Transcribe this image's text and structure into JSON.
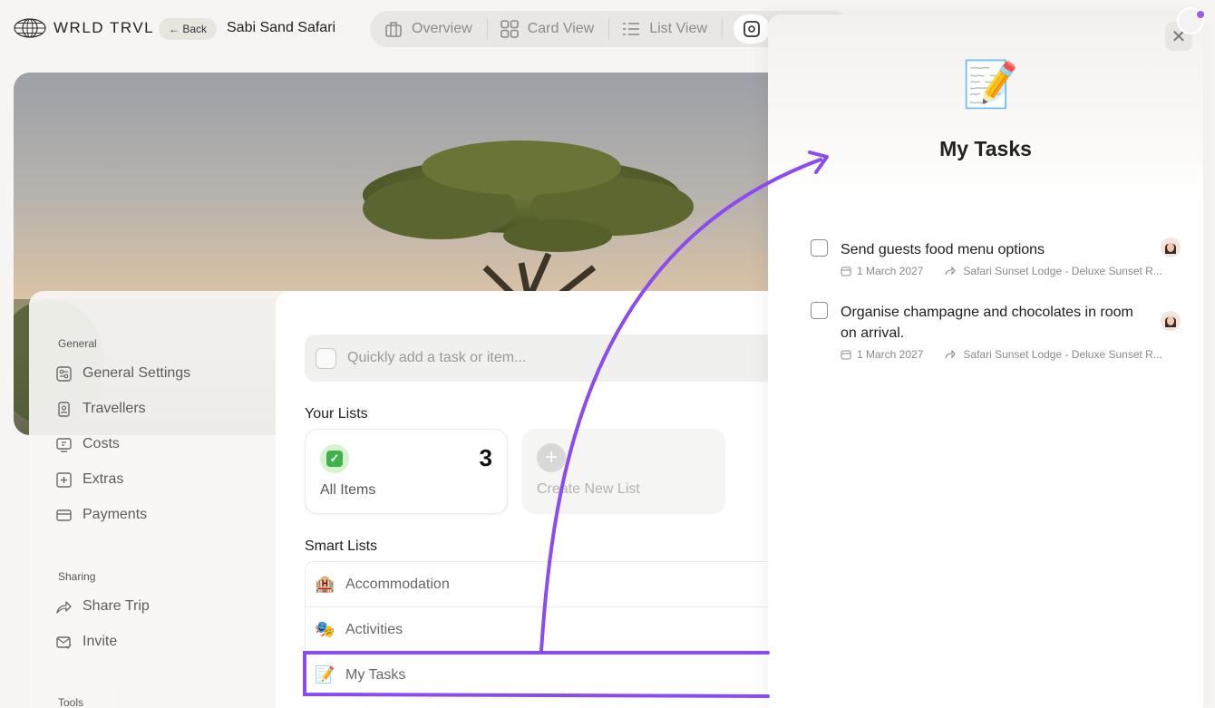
{
  "header": {
    "logo_text": "WRLD TRVL",
    "back_label": "← Back",
    "trip_name": "Sabi Sand Safari",
    "view_tabs": [
      {
        "label": "Overview",
        "icon": "suitcase-icon"
      },
      {
        "label": "Card View",
        "icon": "grid-icon"
      },
      {
        "label": "List View",
        "icon": "list-icon"
      }
    ]
  },
  "sidebar": {
    "sections": [
      {
        "title": "General",
        "items": [
          {
            "label": "General Settings",
            "icon": "settings-icon"
          },
          {
            "label": "Travellers",
            "icon": "badge-icon"
          },
          {
            "label": "Costs",
            "icon": "costs-icon"
          },
          {
            "label": "Extras",
            "icon": "add-box-icon"
          },
          {
            "label": "Payments",
            "icon": "card-icon"
          }
        ]
      },
      {
        "title": "Sharing",
        "items": [
          {
            "label": "Share Trip",
            "icon": "share-icon"
          },
          {
            "label": "Invite",
            "icon": "invite-icon"
          }
        ]
      },
      {
        "title": "Tools",
        "items": []
      }
    ]
  },
  "main": {
    "quick_add_placeholder": "Quickly add a task or item...",
    "your_lists_label": "Your Lists",
    "all_items": {
      "label": "All Items",
      "count": "3"
    },
    "create_new_list_label": "Create New List",
    "smart_lists_label": "Smart Lists",
    "smart_lists": [
      {
        "label": "Accommodation",
        "emoji": "🏨"
      },
      {
        "label": "Activities",
        "emoji": "🎭"
      },
      {
        "label": "My Tasks",
        "emoji": "📝"
      }
    ]
  },
  "drawer": {
    "emoji": "📝",
    "title": "My Tasks",
    "tasks": [
      {
        "title": "Send guests food menu options",
        "date": "1 March 2027",
        "location": "Safari Sunset Lodge - Deluxe Sunset R..."
      },
      {
        "title": "Organise champagne and chocolates in room on arrival.",
        "date": "1 March 2027",
        "location": "Safari Sunset Lodge - Deluxe Sunset R..."
      }
    ]
  },
  "colors": {
    "accent_purple": "#8a4cf0",
    "check_green": "#3cb44a"
  }
}
